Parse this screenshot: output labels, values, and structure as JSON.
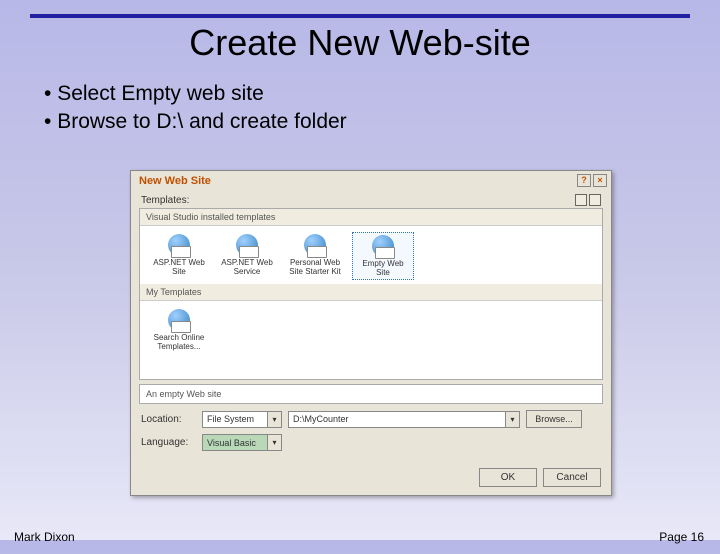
{
  "slide": {
    "title": "Create New Web-site",
    "bullets": [
      "Select Empty web site",
      "Browse to D:\\ and create folder"
    ],
    "footer_author": "Mark Dixon",
    "footer_page": "Page 16"
  },
  "dialog": {
    "title": "New Web Site",
    "templates_label": "Templates:",
    "group1_header": "Visual Studio installed templates",
    "group2_header": "My Templates",
    "templates": [
      {
        "label": "ASP.NET Web Site"
      },
      {
        "label": "ASP.NET Web Service"
      },
      {
        "label": "Personal Web Site Starter Kit"
      },
      {
        "label": "Empty Web Site"
      }
    ],
    "my_templates": [
      {
        "label": "Search Online Templates..."
      }
    ],
    "description": "An empty Web site",
    "location_label": "Location:",
    "location_type": "File System",
    "location_value": "D:\\MyCounter",
    "browse_label": "Browse...",
    "language_label": "Language:",
    "language_value": "Visual Basic",
    "ok_label": "OK",
    "cancel_label": "Cancel"
  }
}
